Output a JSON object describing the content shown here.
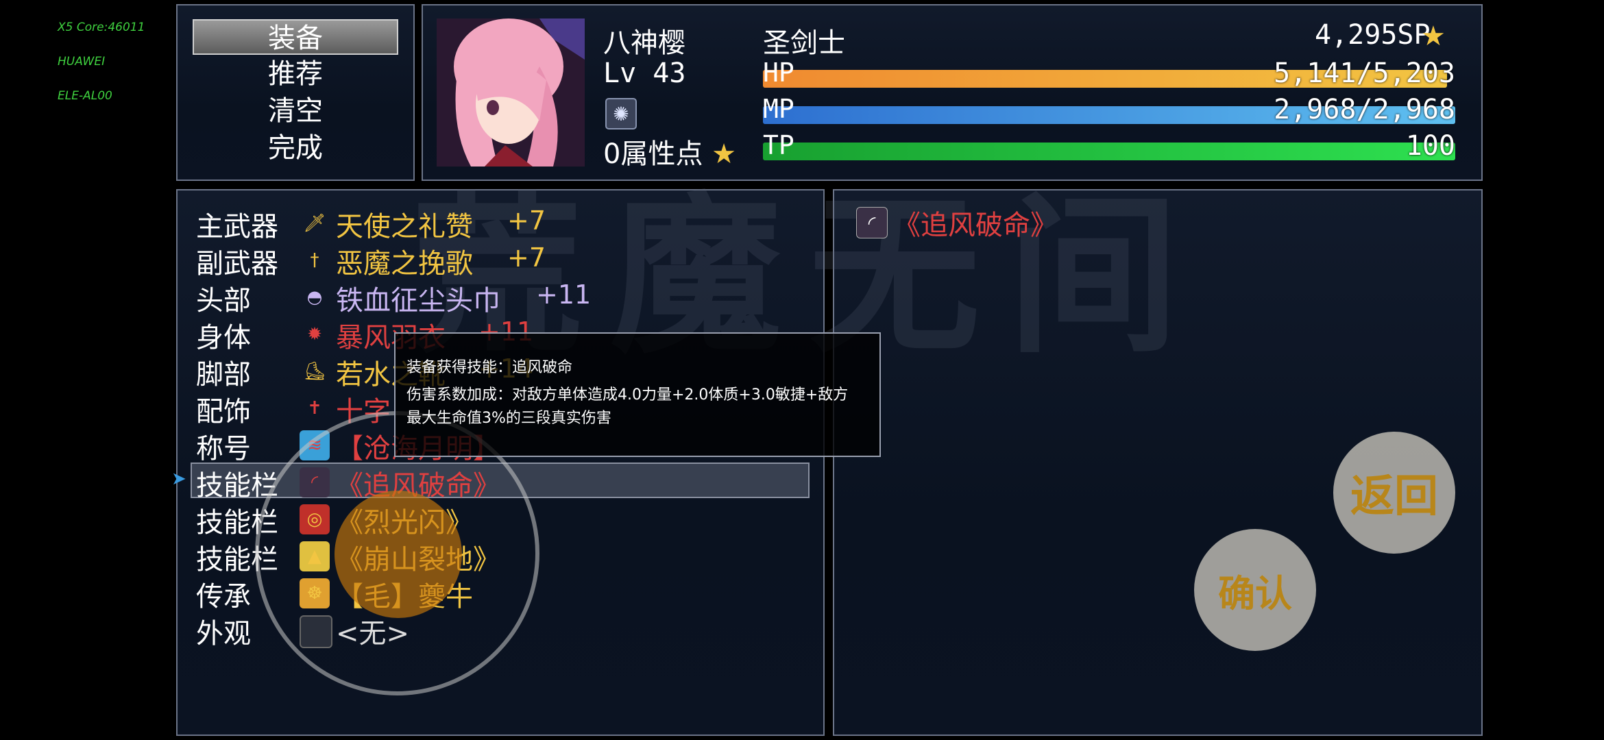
{
  "debug": [
    "X5 Core:46011",
    "HUAWEI",
    "ELE-AL00"
  ],
  "commands": [
    "装备",
    "推荐",
    "清空",
    "完成"
  ],
  "actor": {
    "name": "八神樱",
    "class": "圣剑士",
    "level": "Lv 43",
    "sp": "4,295SP",
    "attr_points": "0属性点",
    "hp_label": "HP",
    "hp_value": "5,141/5,203",
    "hp_ratio": 0.988,
    "mp_label": "MP",
    "mp_value": "2,968/2,968",
    "mp_ratio": 1.0,
    "tp_label": "TP",
    "tp_value": "100",
    "tp_ratio": 1.0
  },
  "slots": [
    {
      "label": "主武器",
      "name": "天使之礼赞",
      "plus": "+7",
      "color": "#f2c542",
      "icon": "sword-icon"
    },
    {
      "label": "副武器",
      "name": "恶魔之挽歌",
      "plus": "+7",
      "color": "#f2c542",
      "icon": "dagger-icon"
    },
    {
      "label": "头部",
      "name": "铁血征尘头巾",
      "plus": "+11",
      "color": "#c9b6f2",
      "icon": "helmet-icon"
    },
    {
      "label": "身体",
      "name": "暴风羽衣",
      "plus": "+11",
      "color": "#e04040",
      "icon": "armor-icon"
    },
    {
      "label": "脚部",
      "name": "若水之靴",
      "plus": "+14",
      "color": "#f2c542",
      "icon": "boots-icon"
    },
    {
      "label": "配饰",
      "name": "十字",
      "plus": "",
      "color": "#e04040",
      "icon": "cross-icon"
    },
    {
      "label": "称号",
      "name": "【沧海月明】",
      "plus": "",
      "color": "#e04040",
      "icon": "wave-icon"
    },
    {
      "label": "技能栏",
      "name": "《追风破命》",
      "plus": "",
      "color": "#e04040",
      "icon": "wind-icon"
    },
    {
      "label": "技能栏",
      "name": "《烈光闪》",
      "plus": "",
      "color": "#f2c542",
      "icon": "flash-icon"
    },
    {
      "label": "技能栏",
      "name": "《崩山裂地》",
      "plus": "",
      "color": "#f2c542",
      "icon": "mountain-icon"
    },
    {
      "label": "传承",
      "name": "【毛】夔牛",
      "plus": "",
      "color": "#f2c542",
      "icon": "ox-icon"
    },
    {
      "label": "外观",
      "name": "<无>",
      "plus": "",
      "color": "#dddddd",
      "icon": "empty-icon"
    }
  ],
  "selected_item": "《追风破命》",
  "tooltip": {
    "line1": "装备获得技能：追风破命",
    "line2": "伤害系数加成：对敌方单体造成4.0力量+2.0体质+3.0敏捷+敌方",
    "line3": "最大生命值3%的三段真实伤害"
  },
  "buttons": {
    "back": "返回",
    "confirm": "确认"
  },
  "watermark": "荒魔无间",
  "colors": {
    "hp": "#f0a030",
    "mp": "#3a9be0",
    "tp": "#1ec83a",
    "accent": "#f2c542",
    "red": "#e04040"
  }
}
